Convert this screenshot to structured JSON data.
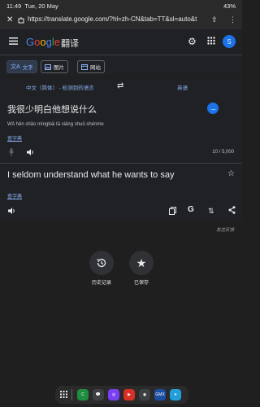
{
  "status": {
    "time": "11:49",
    "date": "Tue, 20 May",
    "battery": "43%"
  },
  "browser": {
    "url": "https://translate.google.com/?hl=zh-CN&tab=TT&sl=auto&t"
  },
  "header": {
    "logo_text": "Google",
    "product": "翻译",
    "avatar_letter": "S"
  },
  "tabs": [
    {
      "label": "文字"
    },
    {
      "label": "图片"
    },
    {
      "label": "网站"
    }
  ],
  "languages": {
    "source": "中文（简体） - 检测到的语言",
    "target": "英语"
  },
  "source": {
    "text": "我很少明白他想说什么",
    "pinyin": "Wǒ hěn shǎo míngbái tā xiǎng shuō shénme",
    "dict_link": "查字典",
    "count": "10 / 5,000"
  },
  "translation": {
    "text": "I seldom understand what he wants to say",
    "dict_link": "查字典",
    "feedback": "发送反馈"
  },
  "bottom": {
    "history": "历史记录",
    "saved": "已保存"
  },
  "dock_apps": [
    {
      "name": "phone",
      "color": "#1e8e3e",
      "label": "C"
    },
    {
      "name": "chat",
      "color": "#3c4043",
      "label": "💬"
    },
    {
      "name": "browser",
      "color": "#7b3ff2",
      "label": "◎"
    },
    {
      "name": "video",
      "color": "#d93025",
      "label": "▶"
    },
    {
      "name": "camera",
      "color": "#3c4043",
      "label": "◉"
    },
    {
      "name": "gmx",
      "color": "#1a4fa0",
      "label": "GMX"
    },
    {
      "name": "telegram",
      "color": "#229ed9",
      "label": "➤"
    }
  ]
}
